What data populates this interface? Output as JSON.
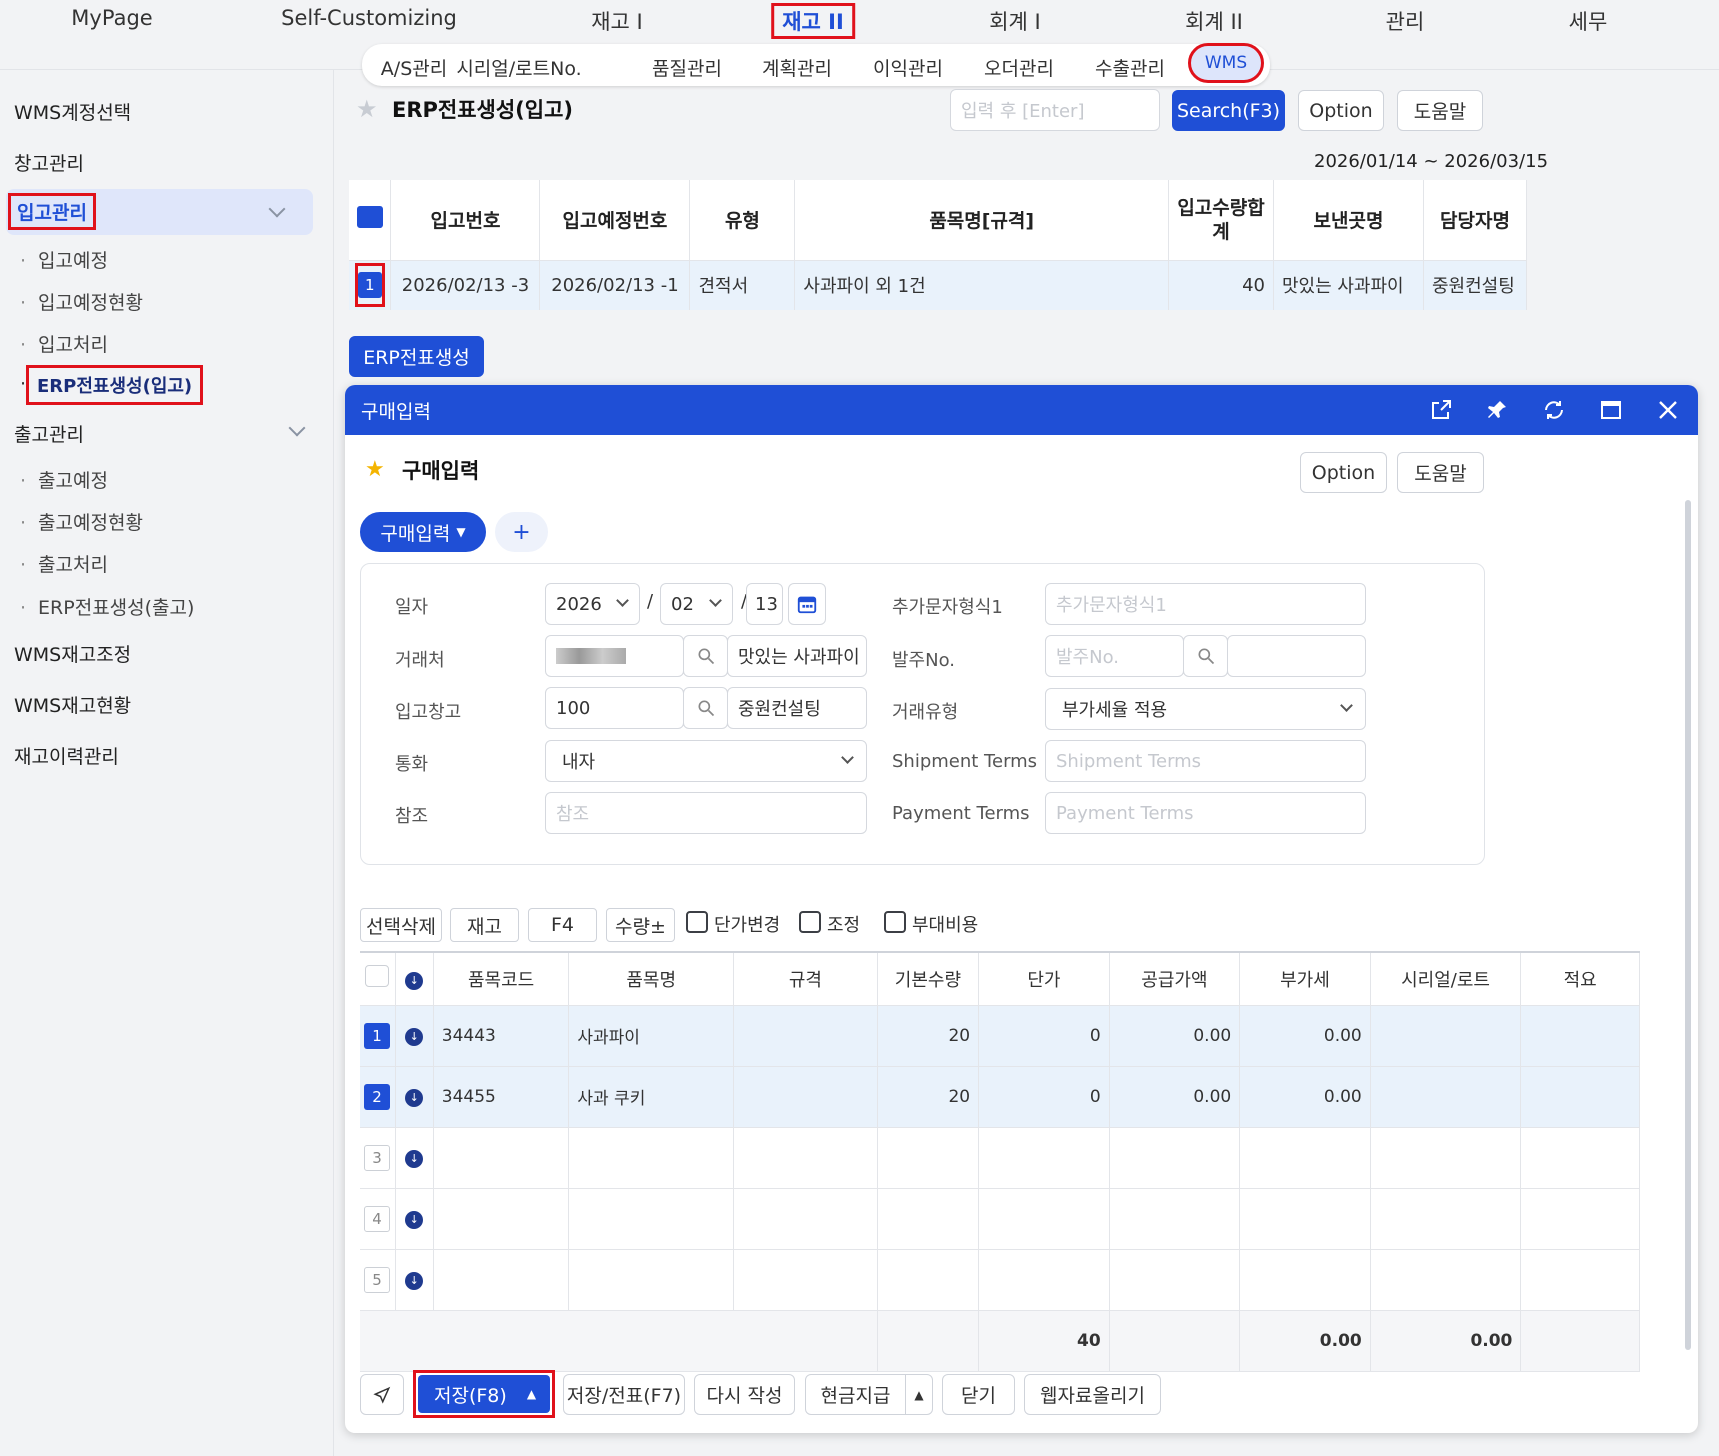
{
  "topnav": {
    "items": [
      "MyPage",
      "Self-Customizing",
      "재고 I",
      "재고 II",
      "회계 I",
      "회계 II",
      "관리",
      "세무"
    ]
  },
  "subnav": {
    "items": [
      "A/S관리",
      "시리얼/로트No.",
      "품질관리",
      "계획관리",
      "이익관리",
      "오더관리",
      "수출관리",
      "WMS"
    ]
  },
  "sidebar": {
    "items": [
      {
        "label": "WMS계정선택"
      },
      {
        "label": "창고관리"
      },
      {
        "label": "입고관리"
      },
      {
        "label": "입고예정"
      },
      {
        "label": "입고예정현황"
      },
      {
        "label": "입고처리"
      },
      {
        "label": "ERP전표생성(입고)"
      },
      {
        "label": "출고관리"
      },
      {
        "label": "출고예정"
      },
      {
        "label": "출고예정현황"
      },
      {
        "label": "출고처리"
      },
      {
        "label": "ERP전표생성(출고)"
      },
      {
        "label": "WMS재고조정"
      },
      {
        "label": "WMS재고현황"
      },
      {
        "label": "재고이력관리"
      }
    ]
  },
  "page": {
    "title": "ERP전표생성(입고)",
    "search_placeholder": "입력 후 [Enter]",
    "search_button": "Search(F3)",
    "option_button": "Option",
    "help_button": "도움말",
    "date_range": "2026/01/14 ~ 2026/03/15",
    "create_button": "ERP전표생성"
  },
  "list_table": {
    "headers": [
      "입고번호",
      "입고예정번호",
      "유형",
      "품목명[규격]",
      "입고수량합계",
      "보낸곳명",
      "담당자명"
    ],
    "rows": [
      {
        "no": "1",
        "receipt_no": "2026/02/13 -3",
        "planned_no": "2026/02/13 -1",
        "type": "견적서",
        "item": "사과파이 외 1건",
        "qty": "40",
        "sender": "맛있는 사과파이",
        "manager": "중원컨설팅"
      }
    ]
  },
  "modal": {
    "window_title": "구매입력",
    "title": "구매입력",
    "option_button": "Option",
    "help_button": "도움말",
    "tab_label": "구매입력",
    "add_tab": "+",
    "form": {
      "date_label": "일자",
      "year": "2026",
      "month": "02",
      "day": "13",
      "sep": "/",
      "vendor_label": "거래처",
      "vendor_name": "맛있는 사과파이",
      "warehouse_label": "입고창고",
      "warehouse_code": "100",
      "warehouse_name": "중원컨설팅",
      "currency_label": "통화",
      "currency_value": "내자",
      "ref_label": "참조",
      "ref_placeholder": "참조",
      "extra1_label": "추가문자형식1",
      "extra1_placeholder": "추가문자형식1",
      "po_label": "발주No.",
      "po_placeholder": "발주No.",
      "tradetype_label": "거래유형",
      "tradetype_value": "부가세율 적용",
      "shipment_label": "Shipment Terms",
      "shipment_placeholder": "Shipment Terms",
      "payment_label": "Payment Terms",
      "payment_placeholder": "Payment Terms"
    },
    "toolbar": {
      "delete": "선택삭제",
      "stock": "재고",
      "f4": "F4",
      "qty": "수량±",
      "price_change": "단가변경",
      "adjust": "조정",
      "extra_cost": "부대비용"
    },
    "grid": {
      "headers": [
        "품목코드",
        "품목명",
        "규격",
        "기본수량",
        "단가",
        "공급가액",
        "부가세",
        "시리얼/로트",
        "적요"
      ],
      "rows": [
        {
          "no": "1",
          "code": "34443",
          "name": "사과파이",
          "spec": "",
          "qty": "20",
          "price": "0",
          "supply": "0.00",
          "vat": "0.00",
          "serial": "",
          "note": ""
        },
        {
          "no": "2",
          "code": "34455",
          "name": "사과 쿠키",
          "spec": "",
          "qty": "20",
          "price": "0",
          "supply": "0.00",
          "vat": "0.00",
          "serial": "",
          "note": ""
        },
        {
          "no": "3",
          "code": "",
          "name": "",
          "spec": "",
          "qty": "",
          "price": "",
          "supply": "",
          "vat": "",
          "serial": "",
          "note": ""
        },
        {
          "no": "4",
          "code": "",
          "name": "",
          "spec": "",
          "qty": "",
          "price": "",
          "supply": "",
          "vat": "",
          "serial": "",
          "note": ""
        },
        {
          "no": "5",
          "code": "",
          "name": "",
          "spec": "",
          "qty": "",
          "price": "",
          "supply": "",
          "vat": "",
          "serial": "",
          "note": ""
        }
      ],
      "totals": {
        "qty": "40",
        "supply": "0.00",
        "vat": "0.00"
      }
    },
    "footer": {
      "save": "저장(F8)",
      "save_slip": "저장/전표(F7)",
      "rewrite": "다시 작성",
      "cash": "현금지급",
      "close": "닫기",
      "upload": "웹자료올리기"
    }
  },
  "colors": {
    "accent": "#1f4fd6",
    "highlight_red": "#e0111b",
    "row_selected": "#e9f2fb"
  },
  "icons": [
    "star-icon",
    "search-icon",
    "calendar-icon",
    "external-link-icon",
    "pin-icon",
    "refresh-icon",
    "maximize-icon",
    "close-icon",
    "chevron-down-icon",
    "down-arrow-circle-icon",
    "send-icon",
    "caret-up-icon"
  ]
}
